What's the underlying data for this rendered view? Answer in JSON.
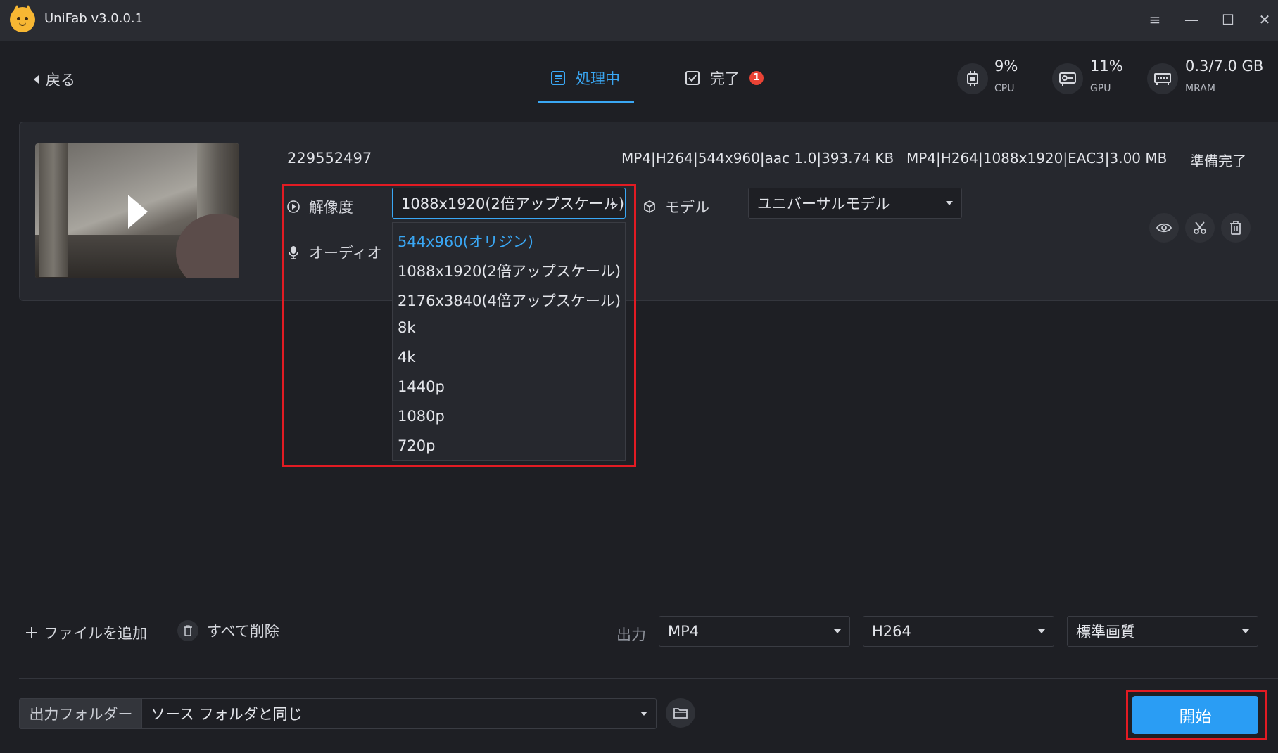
{
  "app": {
    "title": "UniFab v3.0.0.1"
  },
  "window_controls": {
    "menu": "≡",
    "minimize": "—",
    "maximize": "☐",
    "close": "✕"
  },
  "header": {
    "back_label": "戻る",
    "tabs": [
      {
        "label": "処理中",
        "active": true
      },
      {
        "label": "完了",
        "badge": "1"
      }
    ],
    "stats": [
      {
        "value": "9%",
        "label": "CPU"
      },
      {
        "value": "11%",
        "label": "GPU"
      },
      {
        "value": "0.3/7.0 GB",
        "label": "MRAM"
      }
    ]
  },
  "task": {
    "filename": "229552497",
    "source_info": "MP4|H264|544x960|aac 1.0|393.74 KB",
    "arrow": "»",
    "target_info": "MP4|H264|1088x1920|EAC3|3.00 MB",
    "status": "準備完了",
    "resolution": {
      "label": "解像度",
      "selected": "1088x1920(2倍アップスケール)",
      "options": [
        "544x960(オリジン)",
        "1088x1920(2倍アップスケール)",
        "2176x3840(4倍アップスケール)",
        "8k",
        "4k",
        "1440p",
        "1080p",
        "720p"
      ],
      "highlighted_option": "544x960(オリジン)"
    },
    "audio": {
      "label": "オーディオ"
    },
    "model": {
      "label": "モデル",
      "selected": "ユニバーサルモデル"
    }
  },
  "toolbar": {
    "add_file": "ファイルを追加",
    "delete_all": "すべて削除",
    "output_label": "出力",
    "format": "MP4",
    "codec": "H264",
    "quality": "標準画質"
  },
  "output_folder": {
    "label": "出力フォルダー",
    "value": "ソース フォルダと同じ"
  },
  "start_button": "開始",
  "colors": {
    "accent": "#2a9df4",
    "highlight_box": "#e21b23",
    "background": "#1e1f24",
    "titlebar": "#2a2c32"
  }
}
